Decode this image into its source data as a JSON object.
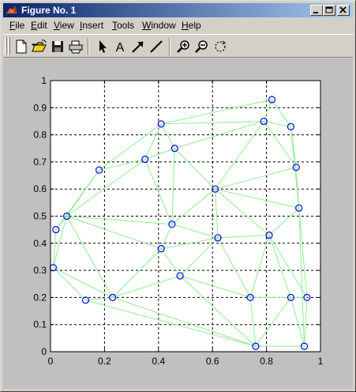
{
  "window": {
    "title": "Figure No. 1",
    "buttons": [
      "_",
      "□",
      "×"
    ]
  },
  "menu": [
    {
      "label": "File",
      "mnemonic": "F"
    },
    {
      "label": "Edit",
      "mnemonic": "E"
    },
    {
      "label": "View",
      "mnemonic": "V"
    },
    {
      "label": "Insert",
      "mnemonic": "I"
    },
    {
      "label": "Tools",
      "mnemonic": "T"
    },
    {
      "label": "Window",
      "mnemonic": "W"
    },
    {
      "label": "Help",
      "mnemonic": "H"
    }
  ],
  "toolbar": {
    "buttons": [
      "new-file-icon",
      "open-folder-icon",
      "save-icon",
      "print-icon",
      "select-arrow-icon",
      "insert-text-icon",
      "insert-arrow-icon",
      "insert-line-icon",
      "zoom-in-icon",
      "zoom-out-icon",
      "rotate-icon"
    ],
    "text_tool_glyph": "A"
  },
  "chart_data": {
    "type": "scatter",
    "subtype": "delaunay-triangulation",
    "title": "",
    "xlabel": "",
    "ylabel": "",
    "xlim": [
      0,
      1
    ],
    "ylim": [
      0,
      1
    ],
    "xticks": [
      "0",
      "0.2",
      "0.4",
      "0.6",
      "0.8",
      "1"
    ],
    "yticks": [
      "0",
      "0.1",
      "0.2",
      "0.3",
      "0.4",
      "0.5",
      "0.6",
      "0.7",
      "0.8",
      "0.9",
      "1"
    ],
    "grid": true,
    "marker_color": "#0000ff",
    "edge_color": "#90ee90",
    "points": [
      [
        0.82,
        0.93
      ],
      [
        0.41,
        0.84
      ],
      [
        0.79,
        0.85
      ],
      [
        0.89,
        0.83
      ],
      [
        0.46,
        0.75
      ],
      [
        0.35,
        0.71
      ],
      [
        0.18,
        0.67
      ],
      [
        0.91,
        0.68
      ],
      [
        0.61,
        0.6
      ],
      [
        0.92,
        0.53
      ],
      [
        0.06,
        0.5
      ],
      [
        0.45,
        0.47
      ],
      [
        0.02,
        0.45
      ],
      [
        0.81,
        0.43
      ],
      [
        0.62,
        0.42
      ],
      [
        0.41,
        0.38
      ],
      [
        0.01,
        0.31
      ],
      [
        0.48,
        0.28
      ],
      [
        0.23,
        0.2
      ],
      [
        0.13,
        0.19
      ],
      [
        0.74,
        0.2
      ],
      [
        0.89,
        0.2
      ],
      [
        0.95,
        0.2
      ],
      [
        0.76,
        0.02
      ],
      [
        0.94,
        0.02
      ]
    ],
    "edges": [
      [
        0,
        1
      ],
      [
        0,
        2
      ],
      [
        0,
        3
      ],
      [
        2,
        3
      ],
      [
        1,
        2
      ],
      [
        1,
        4
      ],
      [
        2,
        4
      ],
      [
        1,
        5
      ],
      [
        1,
        6
      ],
      [
        5,
        6
      ],
      [
        4,
        5
      ],
      [
        3,
        7
      ],
      [
        2,
        7
      ],
      [
        2,
        8
      ],
      [
        4,
        8
      ],
      [
        7,
        8
      ],
      [
        7,
        9
      ],
      [
        8,
        9
      ],
      [
        6,
        10
      ],
      [
        5,
        10
      ],
      [
        5,
        11
      ],
      [
        4,
        11
      ],
      [
        8,
        11
      ],
      [
        10,
        12
      ],
      [
        6,
        12
      ],
      [
        10,
        11
      ],
      [
        8,
        13
      ],
      [
        9,
        13
      ],
      [
        8,
        14
      ],
      [
        11,
        14
      ],
      [
        13,
        14
      ],
      [
        10,
        15
      ],
      [
        11,
        15
      ],
      [
        14,
        15
      ],
      [
        12,
        16
      ],
      [
        10,
        16
      ],
      [
        15,
        17
      ],
      [
        14,
        17
      ],
      [
        15,
        18
      ],
      [
        16,
        18
      ],
      [
        10,
        18
      ],
      [
        17,
        18
      ],
      [
        16,
        19
      ],
      [
        18,
        19
      ],
      [
        14,
        20
      ],
      [
        13,
        20
      ],
      [
        17,
        20
      ],
      [
        13,
        21
      ],
      [
        20,
        21
      ],
      [
        9,
        22
      ],
      [
        13,
        22
      ],
      [
        21,
        22
      ],
      [
        18,
        23
      ],
      [
        19,
        23
      ],
      [
        17,
        23
      ],
      [
        20,
        23
      ],
      [
        21,
        23
      ],
      [
        21,
        24
      ],
      [
        22,
        24
      ],
      [
        23,
        24
      ],
      [
        3,
        9
      ],
      [
        9,
        24
      ]
    ]
  }
}
